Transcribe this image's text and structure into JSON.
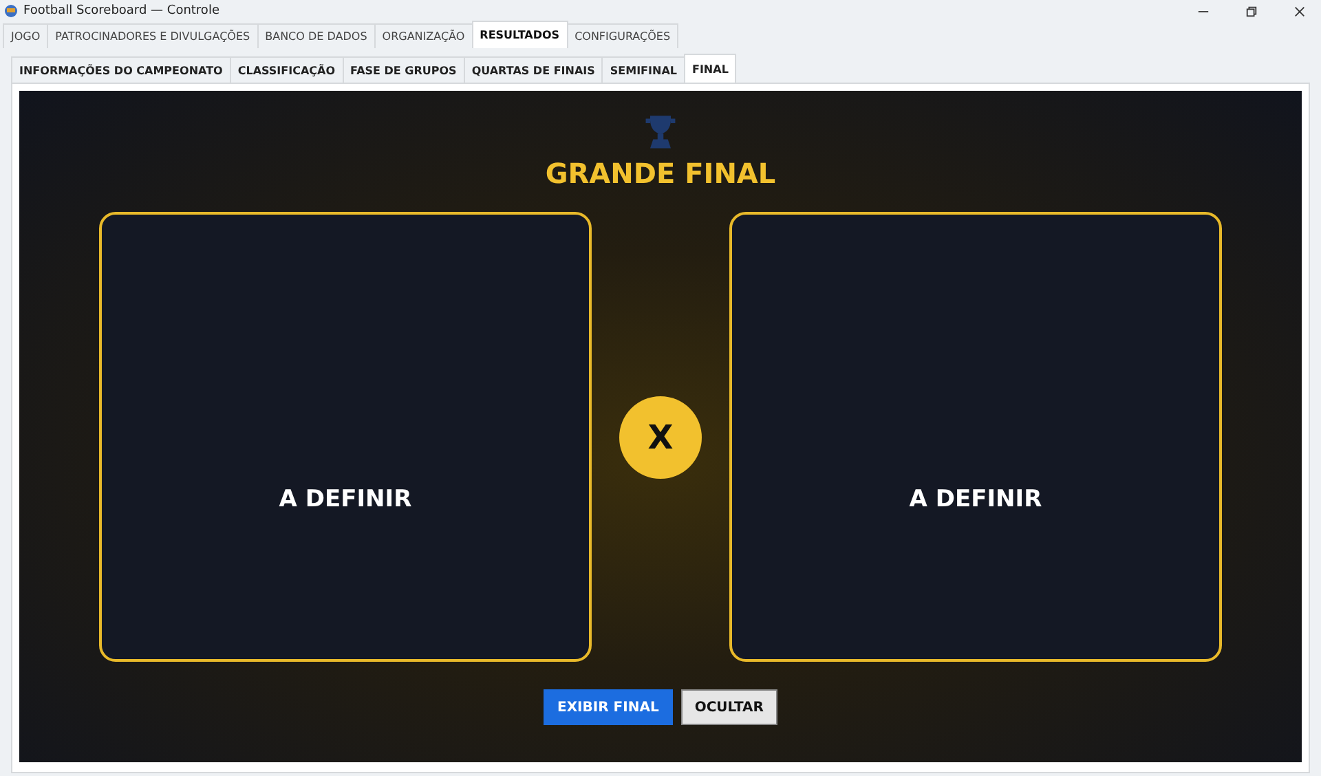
{
  "window": {
    "title": "Football Scoreboard — Controle"
  },
  "tabs": [
    {
      "label": "JOGO",
      "selected": false
    },
    {
      "label": "PATROCINADORES E DIVULGAÇÕES",
      "selected": false
    },
    {
      "label": "BANCO DE DADOS",
      "selected": false
    },
    {
      "label": "ORGANIZAÇÃO",
      "selected": false
    },
    {
      "label": "RESULTADOS",
      "selected": true
    },
    {
      "label": "CONFIGURAÇÕES",
      "selected": false
    }
  ],
  "subtabs": [
    {
      "label": "INFORMAÇÕES DO CAMPEONATO",
      "selected": false
    },
    {
      "label": "CLASSIFICAÇÃO",
      "selected": false
    },
    {
      "label": "FASE DE GRUPOS",
      "selected": false
    },
    {
      "label": "QUARTAS DE FINAIS",
      "selected": false
    },
    {
      "label": "SEMIFINAL",
      "selected": false
    },
    {
      "label": "FINAL",
      "selected": true
    }
  ],
  "final": {
    "title": "GRANDE FINAL",
    "teams": [
      "A DEFINIR",
      "A DEFINIR"
    ],
    "versus": "X"
  },
  "buttons": [
    {
      "label": "EXIBIR FINAL",
      "kind": "primary"
    },
    {
      "label": "OCULTAR",
      "kind": "secondary"
    }
  ]
}
